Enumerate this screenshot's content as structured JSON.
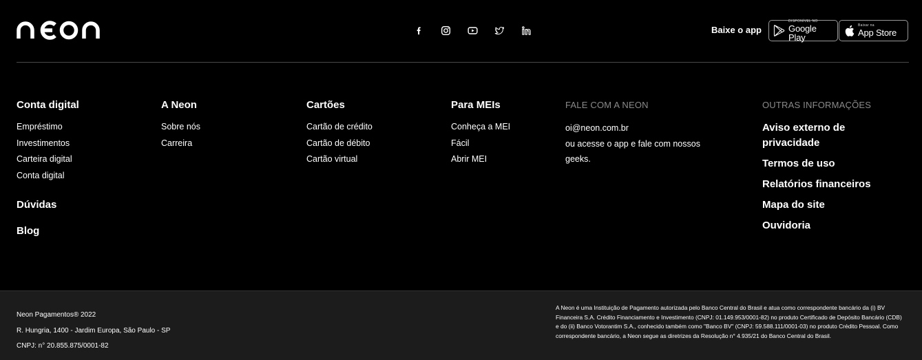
{
  "header": {
    "logo": "neon",
    "socials": [
      "facebook-icon",
      "instagram-icon",
      "youtube-icon",
      "twitter-icon",
      "linkedin-icon"
    ],
    "download_label": "Baixe o app",
    "google_play": {
      "small": "DISPONÍVEL NO",
      "big": "Google Play"
    },
    "app_store": {
      "small": "Baixar na",
      "big": "App Store"
    }
  },
  "columns": {
    "conta": {
      "title": "Conta digital",
      "items": [
        "Empréstimo",
        "Investimentos",
        "Carteira digital",
        "Conta digital"
      ],
      "extra": [
        "Dúvidas",
        "Blog"
      ]
    },
    "aneon": {
      "title": "A Neon",
      "items": [
        "Sobre nós",
        "Carreira"
      ]
    },
    "cartoes": {
      "title": "Cartões",
      "items": [
        "Cartão de crédito",
        "Cartão de débito",
        "Cartão virtual"
      ]
    },
    "meis": {
      "title": "Para MEIs",
      "items": [
        "Conheça a MEI",
        "Fácil",
        "Abrir MEI"
      ]
    },
    "fale": {
      "title": "FALE COM A NEON",
      "email": "oi@neon.com.br",
      "text1": "ou acesse o app e fale com nossos",
      "text2": "geeks."
    },
    "outras": {
      "title": "OUTRAS INFORMAÇÕES",
      "items": [
        "Aviso externo de privacidade",
        "Termos de uso",
        "Relatórios financeiros",
        "Mapa do site",
        "Ouvidoria"
      ]
    }
  },
  "footer": {
    "company": "Neon Pagamentos® 2022",
    "address": "R. Hungria, 1400 - Jardim Europa, São Paulo - SP",
    "cnpj": "CNPJ: n° 20.855.875/0001-82",
    "legal": "A Neon é uma Instituição de Pagamento autorizada pelo Banco Central do Brasil e atua como correspondente bancário da (i) BV Financeira S.A. Crédito Financiamento e Investimento (CNPJ: 01.149.953/0001-82) no produto Certificado de Depósito Bancário (CDB) e do (ii) Banco Votorantim S.A., conhecido também como \"Banco BV\" (CNPJ: 59.588.111/0001-03) no produto Crédito Pessoal. Como correspondente bancário, a Neon segue as diretrizes da Resolução n° 4.935/21 do Banco Central do Brasil."
  }
}
